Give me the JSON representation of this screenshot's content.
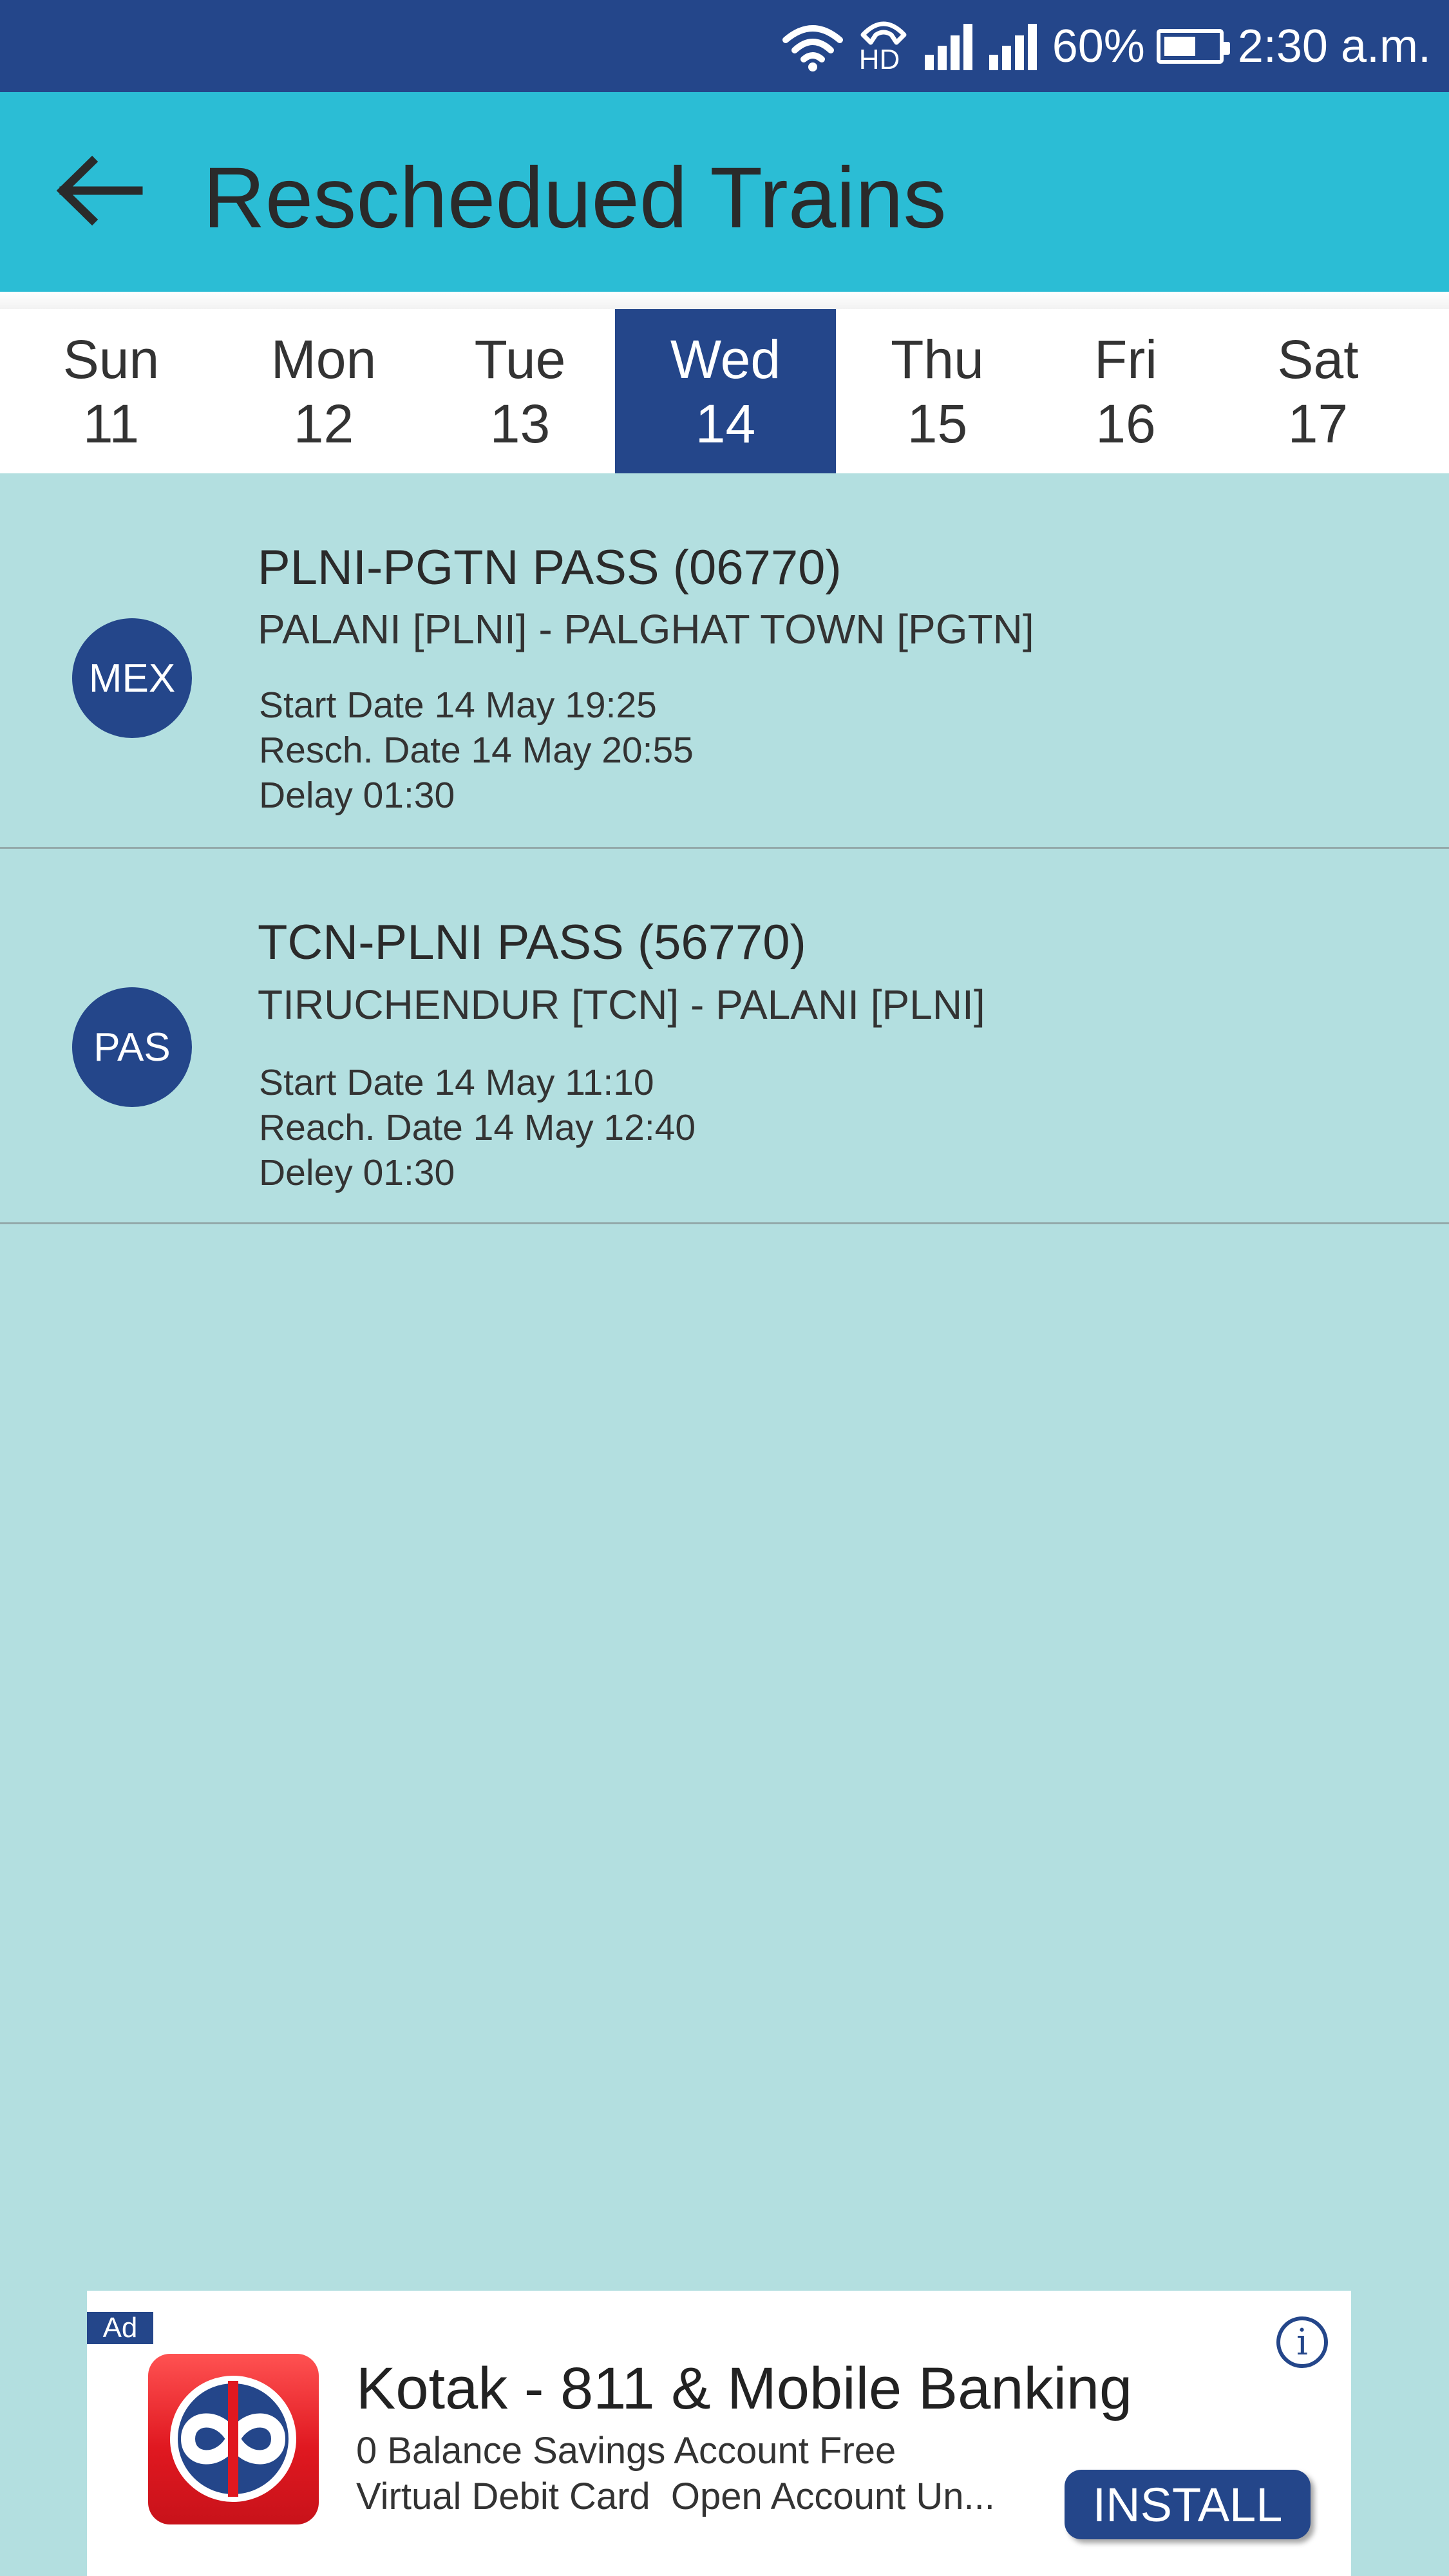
{
  "status_bar": {
    "hd_label": "HD",
    "battery_level": 0.6,
    "battery_text": "60%",
    "time": "2:30 a.m.",
    "icons": [
      "wifi-icon",
      "hd-call-icon",
      "signal-icon",
      "signal-icon",
      "battery-icon"
    ]
  },
  "app_bar": {
    "back_icon": "arrow-left-icon",
    "title": "Reschedued Trains"
  },
  "days": [
    {
      "day": "Sun",
      "date": "11"
    },
    {
      "day": "Mon",
      "date": "12"
    },
    {
      "day": "Tue",
      "date": "13"
    },
    {
      "day": "Wed",
      "date": "14"
    },
    {
      "day": "Thu",
      "date": "15"
    },
    {
      "day": "Fri",
      "date": "16"
    },
    {
      "day": "Sat",
      "date": "17"
    }
  ],
  "selected_day": "Wed",
  "trains": [
    {
      "badge": "MEX",
      "name": "PLNI-PGTN PASS (06770)",
      "route": "PALANI [PLNI] - PALGHAT TOWN [PGTN]",
      "line1": "Start Date 14 May 19:25",
      "line2": "Resch. Date 14 May 20:55",
      "line3": "Delay 01:30"
    },
    {
      "badge": "PAS",
      "name": "TCN-PLNI PASS (56770)",
      "route": "TIRUCHENDUR [TCN] - PALANI [PLNI]",
      "line1": "Start Date 14 May 11:10",
      "line2": "Reach. Date 14 May 12:40",
      "line3": "Deley 01:30"
    }
  ],
  "ad": {
    "tag": "Ad",
    "info_icon": "info-icon",
    "info_glyph": "i",
    "title": "Kotak - 811 & Mobile Banking",
    "line1": "0 Balance Savings Account Free",
    "line2": "Virtual Debit Card  Open Account Un...",
    "install_label": "INSTALL",
    "logo_icon": "kotak-logo-icon"
  },
  "colors": {
    "status_bar": "#24468a",
    "app_bar": "#2bbdd5",
    "content_bg": "#b3dfe0",
    "accent": "#24468a",
    "logo_red": "#e01820"
  }
}
